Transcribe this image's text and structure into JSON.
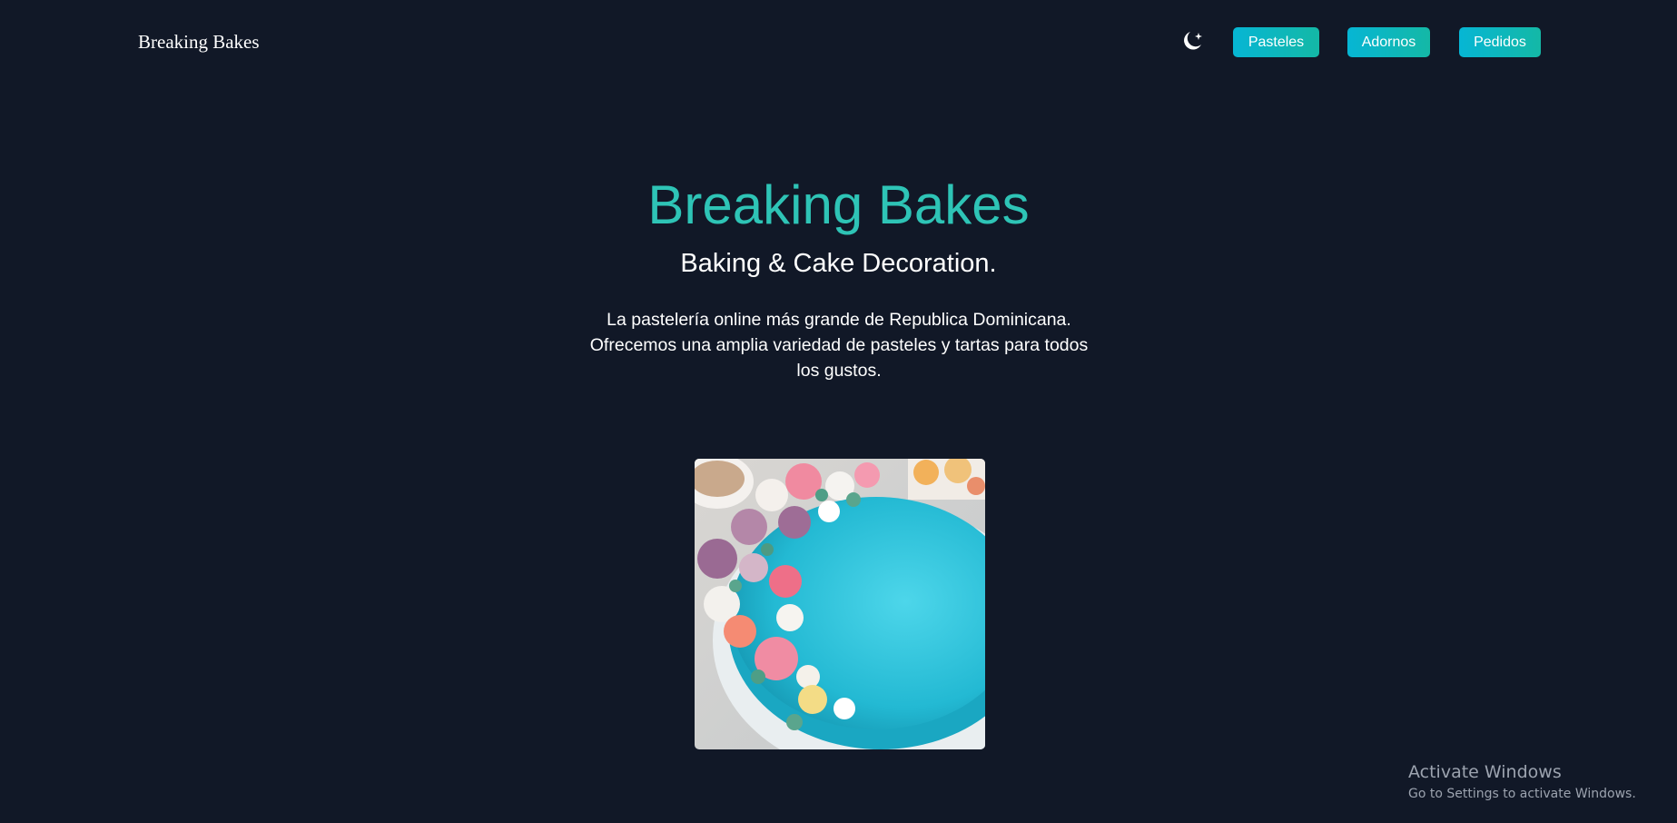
{
  "navbar": {
    "brand": "Breaking Bakes",
    "theme_icon": "moon-stars-icon",
    "links": [
      "Pasteles",
      "Adornos",
      "Pedidos"
    ]
  },
  "hero": {
    "title": "Breaking Bakes",
    "subtitle": "Baking & Cake Decoration.",
    "description": "La pastelería online más grande de Republica Dominicana. Ofrecemos una amplia variedad de pasteles y tartas para todos los gustos.",
    "image": "turquoise-cake-with-buttercream-flowers"
  },
  "os_watermark": {
    "title": "Activate Windows",
    "subtitle": "Go to Settings to activate Windows."
  },
  "colors": {
    "background": "#111827",
    "accent": "#2ec4b6",
    "button_gradient_start": "#06b6d4",
    "button_gradient_end": "#14b8a6"
  }
}
